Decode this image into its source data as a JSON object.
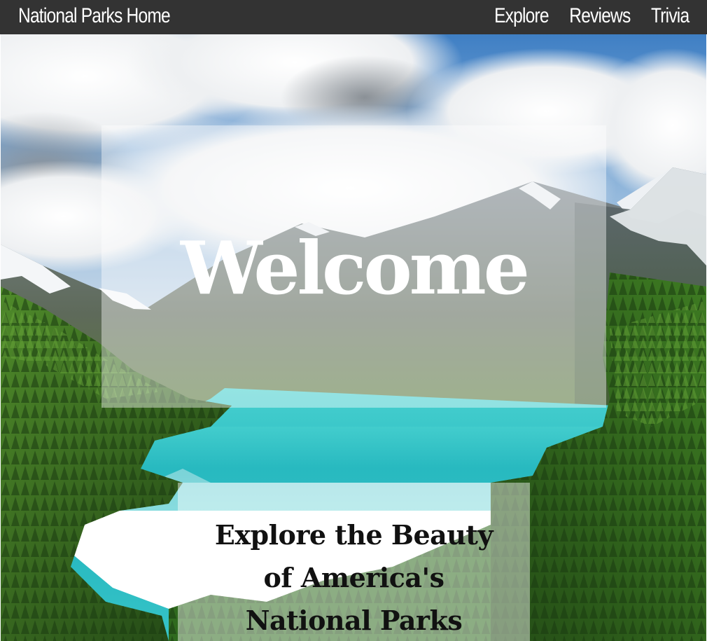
{
  "nav": {
    "home_label": "National Parks Home",
    "links": [
      {
        "label": "Explore"
      },
      {
        "label": "Reviews"
      },
      {
        "label": "Trivia"
      }
    ],
    "background_color": "#333333",
    "text_color": "#ffffff"
  },
  "hero": {
    "welcome_title": "Welcome",
    "tagline": "Explore the Beauty of America's National Parks",
    "scene_colors": {
      "sky": "#4d88c8",
      "cloud": "#f2f3f4",
      "mountain": "#6d7781",
      "snow": "#ffffff",
      "lake": "#3cc6c6",
      "forest": "#2e5a1c"
    }
  }
}
